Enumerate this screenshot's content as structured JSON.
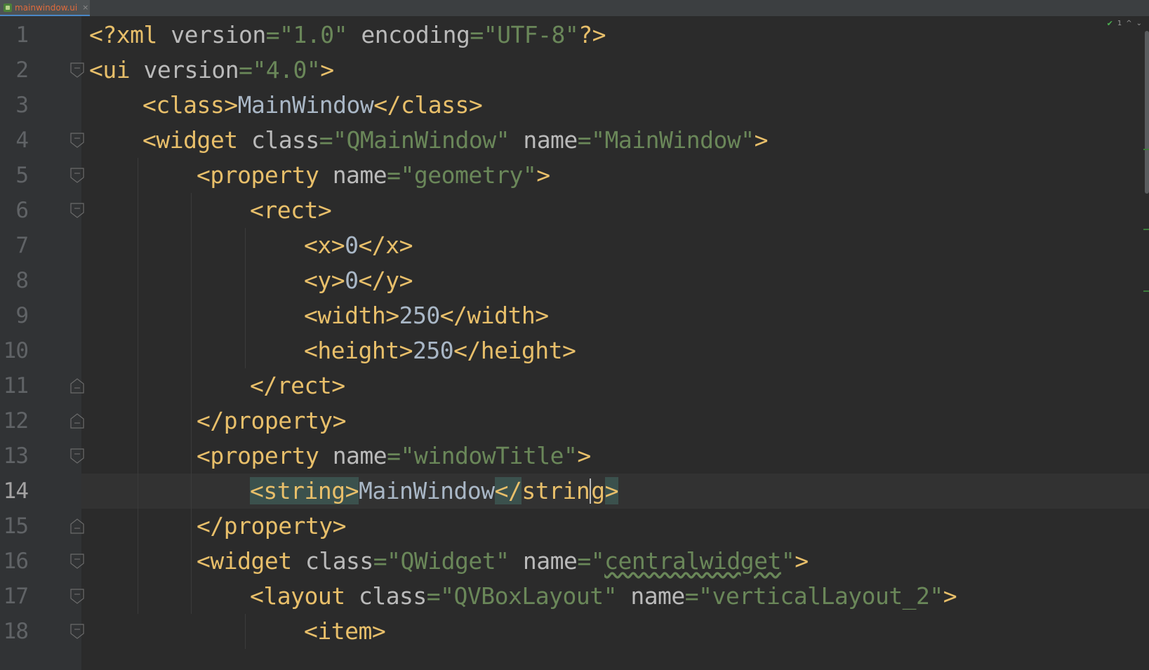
{
  "tab": {
    "filename": "mainwindow.ui",
    "close_glyph": "×",
    "icon": "ui-file-icon"
  },
  "status": {
    "inspection_count": "1",
    "up_glyph": "^",
    "down_glyph": "⌄"
  },
  "current_line": 14,
  "lines": [
    {
      "num": "1",
      "tokens": [
        "<?xml ",
        "version",
        "=",
        "\"1.0\"",
        " encoding",
        "=",
        "\"UTF-8\"",
        "?>"
      ]
    },
    {
      "num": "2",
      "tokens": [
        "<ui ",
        "version",
        "=",
        "\"4.0\"",
        ">"
      ]
    },
    {
      "num": "3",
      "tokens": [
        "<class>",
        "MainWindow",
        "</class>"
      ]
    },
    {
      "num": "4",
      "tokens": [
        "<widget ",
        "class",
        "=",
        "\"QMainWindow\"",
        " name",
        "=",
        "\"MainWindow\"",
        ">"
      ]
    },
    {
      "num": "5",
      "tokens": [
        "<property ",
        "name",
        "=",
        "\"geometry\"",
        ">"
      ]
    },
    {
      "num": "6",
      "tokens": [
        "<rect>"
      ]
    },
    {
      "num": "7",
      "tokens": [
        "<x>",
        "0",
        "</x>"
      ]
    },
    {
      "num": "8",
      "tokens": [
        "<y>",
        "0",
        "</y>"
      ]
    },
    {
      "num": "9",
      "tokens": [
        "<width>",
        "250",
        "</width>"
      ]
    },
    {
      "num": "10",
      "tokens": [
        "<height>",
        "250",
        "</height>"
      ]
    },
    {
      "num": "11",
      "tokens": [
        "</rect>"
      ]
    },
    {
      "num": "12",
      "tokens": [
        "</property>"
      ]
    },
    {
      "num": "13",
      "tokens": [
        "<property ",
        "name",
        "=",
        "\"windowTitle\"",
        ">"
      ]
    },
    {
      "num": "14",
      "tokens": [
        "<string>",
        "MainWindow",
        "</",
        "strin",
        "g",
        ">"
      ]
    },
    {
      "num": "15",
      "tokens": [
        "</property>"
      ]
    },
    {
      "num": "16",
      "tokens": [
        "<widget ",
        "class",
        "=",
        "\"QWidget\"",
        " name",
        "=",
        "\"",
        "centralwidget",
        "\"",
        ">"
      ]
    },
    {
      "num": "17",
      "tokens": [
        "<layout ",
        "class",
        "=",
        "\"QVBoxLayout\"",
        " name",
        "=",
        "\"verticalLayout_2\"",
        ">"
      ]
    },
    {
      "num": "18",
      "tokens": [
        "<item>"
      ]
    }
  ]
}
